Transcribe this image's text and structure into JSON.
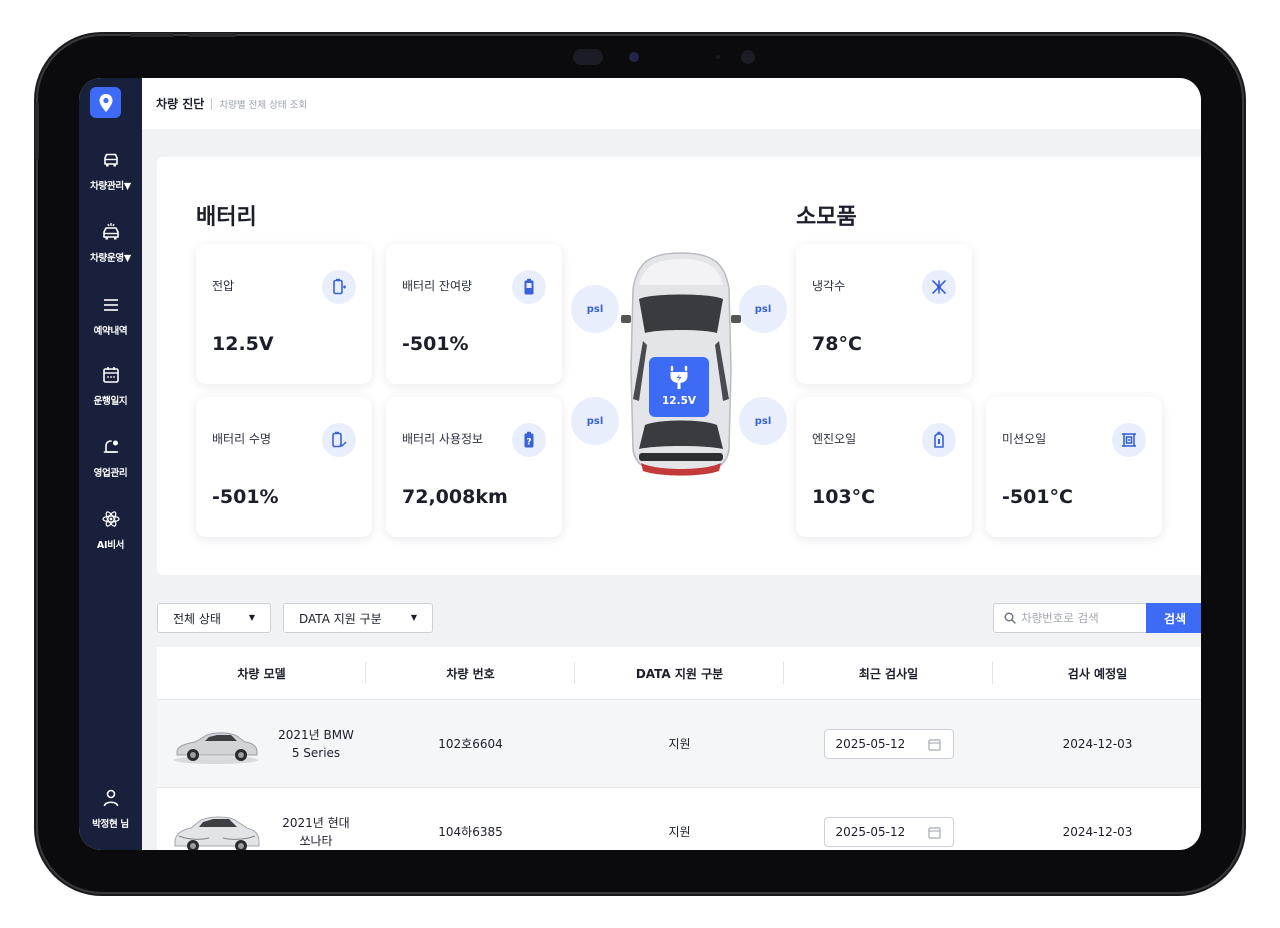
{
  "header": {
    "title": "차량 진단",
    "subtitle": "차량별 전체 상태 조회"
  },
  "sidebar": {
    "items": [
      {
        "label": "차량관리",
        "icon": "car-icon",
        "has_caret": true
      },
      {
        "label": "차량운영",
        "icon": "car-wash-icon",
        "has_caret": true
      },
      {
        "label": "예약내역",
        "icon": "menu-icon",
        "has_caret": false
      },
      {
        "label": "운행일지",
        "icon": "calendar-icon",
        "has_caret": false
      },
      {
        "label": "영업관리",
        "icon": "bell-icon",
        "has_caret": false
      },
      {
        "label": "AI비서",
        "icon": "atom-icon",
        "has_caret": false
      }
    ],
    "user": {
      "label": "박정현 님",
      "icon": "user-icon"
    }
  },
  "battery": {
    "title": "배터리",
    "cards": [
      {
        "label": "전압",
        "value": "12.5V",
        "icon": "battery-charge-icon"
      },
      {
        "label": "배터리 잔여량",
        "value": "-501%",
        "icon": "battery-level-icon"
      },
      {
        "label": "배터리 수명",
        "value": "-501%",
        "icon": "battery-health-icon"
      },
      {
        "label": "배터리 사용정보",
        "value": "72,008km",
        "icon": "battery-info-icon"
      }
    ]
  },
  "vehicle": {
    "tire_unit": "psl",
    "charge_value": "12.5V"
  },
  "consumables": {
    "title": "소모품",
    "cards": [
      {
        "label": "냉각수",
        "value": "78°C",
        "icon": "snowflake-icon"
      },
      {
        "label": "엔진오일",
        "value": "103°C",
        "icon": "oil-can-icon"
      },
      {
        "label": "미션오일",
        "value": "-501°C",
        "icon": "transmission-icon"
      }
    ]
  },
  "filters": {
    "status": "전체 상태",
    "data_support": "DATA 지원 구분",
    "search_placeholder": "차량번호로 검색",
    "search_button": "검색"
  },
  "table": {
    "columns": [
      "차량 모델",
      "차량 번호",
      "DATA 지원 구분",
      "최근 검사일",
      "검사 예정일"
    ],
    "rows": [
      {
        "model_line1": "2021년 BMW",
        "model_line2": "5 Series",
        "plate": "102호6604",
        "support": "지원",
        "last_check": "2025-05-12",
        "next_check": "2024-12-03"
      },
      {
        "model_line1": "2021년 현대",
        "model_line2": "쏘나타",
        "plate": "104하6385",
        "support": "지원",
        "last_check": "2025-05-12",
        "next_check": "2024-12-03"
      }
    ]
  },
  "colors": {
    "sidebar": "#18203c",
    "accent": "#3e6bf6",
    "icon_bg": "#e8eefc"
  }
}
